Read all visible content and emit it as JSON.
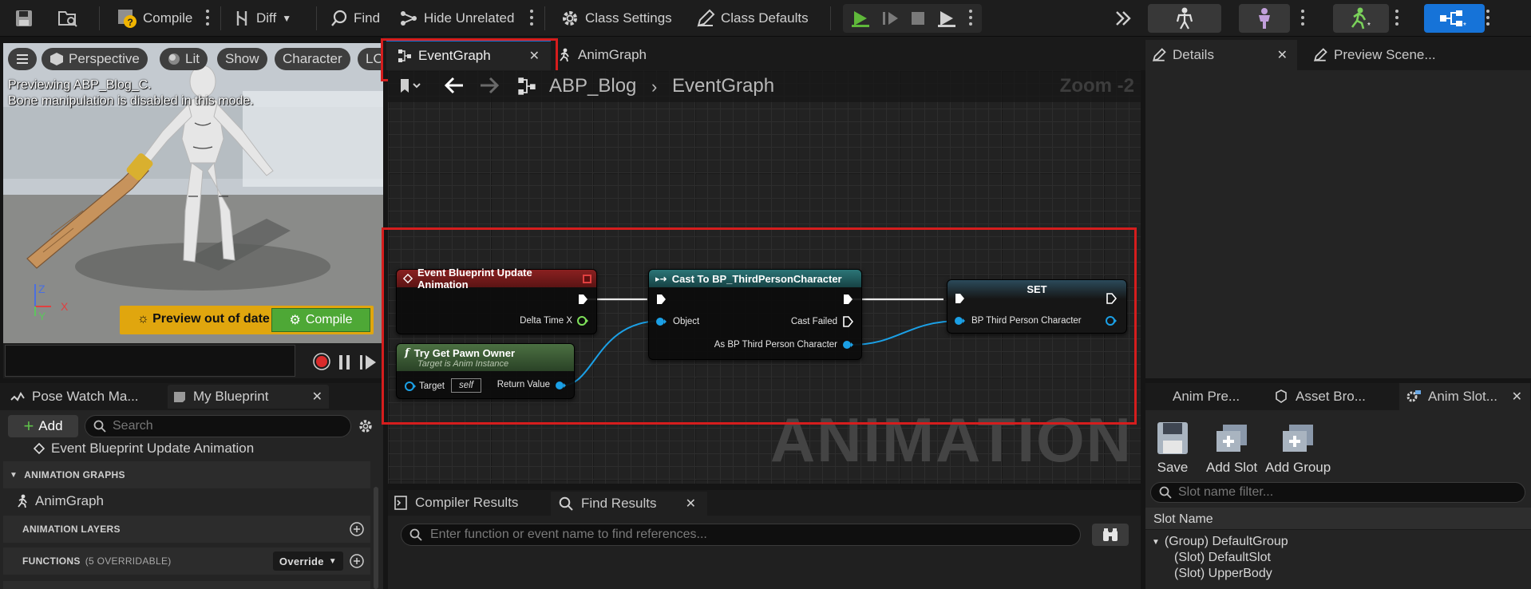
{
  "toolbar": {
    "compile": "Compile",
    "diff": "Diff",
    "find": "Find",
    "hide_unrelated": "Hide Unrelated",
    "class_settings": "Class Settings",
    "class_defaults": "Class Defaults"
  },
  "viewport": {
    "perspective": "Perspective",
    "lit": "Lit",
    "show": "Show",
    "character": "Character",
    "lod": "LO",
    "preview_line1": "Previewing ABP_Blog_C.",
    "preview_line2": "Bone manipulation is disabled in this mode.",
    "axis_z": "Z",
    "axis_y": "Y",
    "axis_x": "X",
    "preview_out_of_date": "Preview out of date",
    "compile": "Compile"
  },
  "left_tabs": {
    "pose_watch": "Pose Watch Ma...",
    "my_blueprint": "My Blueprint"
  },
  "my_blueprint": {
    "add": "Add",
    "search_placeholder": "Search",
    "event_item": "Event Blueprint Update Animation",
    "animation_graphs": "ANIMATION GRAPHS",
    "anim_graph_item": "AnimGraph",
    "animation_layers": "ANIMATION LAYERS",
    "functions": "FUNCTIONS",
    "functions_count": "(5 OVERRIDABLE)",
    "override": "Override"
  },
  "graph_tabs": {
    "event_graph": "EventGraph",
    "anim_graph": "AnimGraph"
  },
  "graph": {
    "crumb_root": "ABP_Blog",
    "crumb_current": "EventGraph",
    "zoom": "Zoom -2",
    "watermark": "ANIMATION"
  },
  "nodes": {
    "event_update": {
      "title": "Event Blueprint Update Animation",
      "pin_delta": "Delta Time X"
    },
    "try_get_pawn": {
      "title": "Try Get Pawn Owner",
      "subtitle": "Target is Anim Instance",
      "pin_target": "Target",
      "target_value": "self",
      "pin_return": "Return Value"
    },
    "cast": {
      "title": "Cast To BP_ThirdPersonCharacter",
      "pin_object": "Object",
      "pin_cast_failed": "Cast Failed",
      "pin_as": "As BP Third Person Character"
    },
    "set": {
      "title": "SET",
      "pin_var": "BP Third Person Character"
    }
  },
  "results": {
    "compiler_results": "Compiler Results",
    "find_results": "Find Results",
    "search_placeholder": "Enter function or event name to find references..."
  },
  "right_tabs": {
    "details": "Details",
    "preview_scene": "Preview Scene..."
  },
  "right_tabs2": {
    "anim_preview": "Anim Pre...",
    "asset_browser": "Asset Bro...",
    "anim_slot": "Anim Slot..."
  },
  "slot_manager": {
    "save": "Save",
    "add_slot": "Add Slot",
    "add_group": "Add Group",
    "filter_placeholder": "Slot name filter...",
    "column": "Slot Name",
    "group": "(Group) DefaultGroup",
    "slot1": "(Slot) DefaultSlot",
    "slot2": "(Slot) UpperBody"
  },
  "colors": {
    "accent_red": "#d51d1d",
    "compile_green": "#4ea836",
    "preview_yellow": "#e0a60e",
    "exec_node_red": "#6e1a1a",
    "pure_node_green": "#3b5a34",
    "cast_teal": "#1f5c5e",
    "object_pin_blue": "#1ba0e6"
  }
}
